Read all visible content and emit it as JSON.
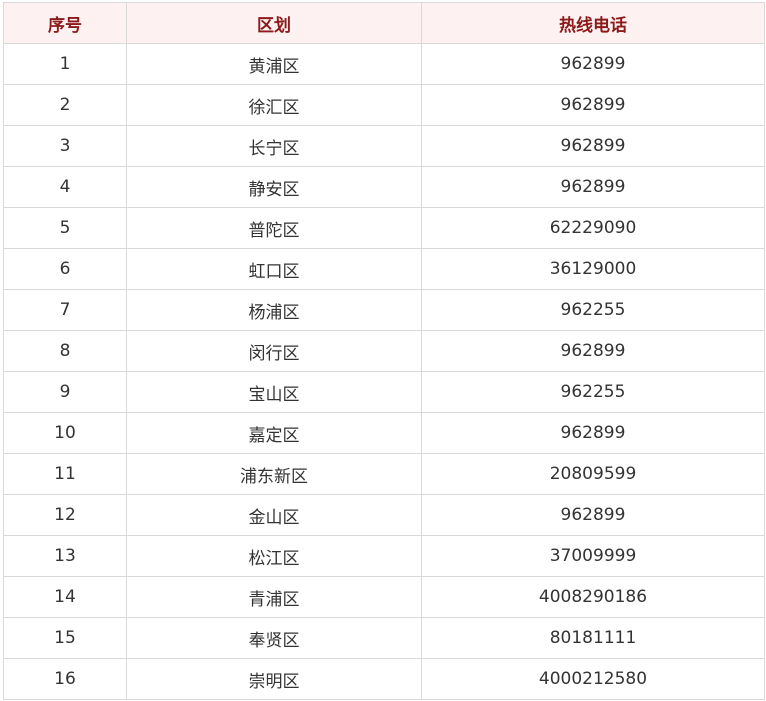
{
  "table": {
    "headers": [
      "序号",
      "区划",
      "热线电话"
    ],
    "rows": [
      [
        "1",
        "黄浦区",
        "962899"
      ],
      [
        "2",
        "徐汇区",
        "962899"
      ],
      [
        "3",
        "长宁区",
        "962899"
      ],
      [
        "4",
        "静安区",
        "962899"
      ],
      [
        "5",
        "普陀区",
        "62229090"
      ],
      [
        "6",
        "虹口区",
        "36129000"
      ],
      [
        "7",
        "杨浦区",
        "962255"
      ],
      [
        "8",
        "闵行区",
        "962899"
      ],
      [
        "9",
        "宝山区",
        "962255"
      ],
      [
        "10",
        "嘉定区",
        "962899"
      ],
      [
        "11",
        "浦东新区",
        "20809599"
      ],
      [
        "12",
        "金山区",
        "962899"
      ],
      [
        "13",
        "松江区",
        "37009999"
      ],
      [
        "14",
        "青浦区",
        "4008290186"
      ],
      [
        "15",
        "奉贤区",
        "80181111"
      ],
      [
        "16",
        "崇明区",
        "4000212580"
      ]
    ]
  },
  "colors": {
    "header_bg": "#fdf1f1",
    "header_text": "#8b1a1a",
    "border": "#d9d9d9",
    "cell_text": "#333333"
  }
}
